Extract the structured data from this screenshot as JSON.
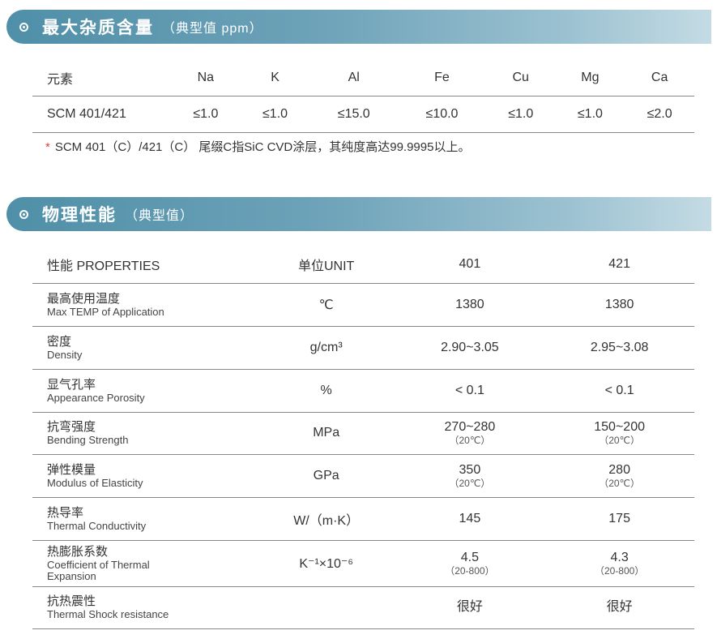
{
  "section1": {
    "title": "最大杂质含量",
    "subtitle": "（典型值 ppm）",
    "headers": [
      "元素",
      "Na",
      "K",
      "Al",
      "Fe",
      "Cu",
      "Mg",
      "Ca"
    ],
    "row": [
      "SCM 401/421",
      "≤1.0",
      "≤1.0",
      "≤15.0",
      "≤10.0",
      "≤1.0",
      "≤1.0",
      "≤2.0"
    ],
    "note_star": "*",
    "note": "SCM 401（C）/421（C） 尾缀C指SiC CVD涂层，其纯度高达99.9995以上。"
  },
  "section2": {
    "title": "物理性能",
    "subtitle": "（典型值）",
    "headers": {
      "prop": "性能 PROPERTIES",
      "unit": "单位UNIT",
      "c401": "401",
      "c421": "421"
    },
    "rows": [
      {
        "zh": "最高使用温度",
        "en": "Max TEMP of Application",
        "unit": "℃",
        "v401": "1380",
        "c401": "",
        "v421": "1380",
        "c421": ""
      },
      {
        "zh": "密度",
        "en": "Density",
        "unit": "g/cm³",
        "v401": "2.90~3.05",
        "c401": "",
        "v421": "2.95~3.08",
        "c421": ""
      },
      {
        "zh": "显气孔率",
        "en": "Appearance Porosity",
        "unit": "%",
        "v401": "< 0.1",
        "c401": "",
        "v421": "< 0.1",
        "c421": ""
      },
      {
        "zh": "抗弯强度",
        "en": "Bending Strength",
        "unit": "MPa",
        "v401": "270~280",
        "c401": "（20℃）",
        "v421": "150~200",
        "c421": "（20℃）"
      },
      {
        "zh": "弹性模量",
        "en": "Modulus of Elasticity",
        "unit": "GPa",
        "v401": "350",
        "c401": "（20℃）",
        "v421": "280",
        "c421": "（20℃）"
      },
      {
        "zh": "热导率",
        "en": "Thermal Conductivity",
        "unit": "W/（m·K）",
        "v401": "145",
        "c401": "",
        "v421": "175",
        "c421": ""
      },
      {
        "zh": "热膨胀系数",
        "en": "Coefficient of Thermal Expansion",
        "unit": "K⁻¹×10⁻⁶",
        "v401": "4.5",
        "c401": "（20-800）",
        "v421": "4.3",
        "c421": "（20-800）"
      },
      {
        "zh": "抗热震性",
        "en": "Thermal Shock resistance",
        "unit": "",
        "v401": "很好",
        "c401": "",
        "v421": "很好",
        "c421": ""
      }
    ]
  }
}
